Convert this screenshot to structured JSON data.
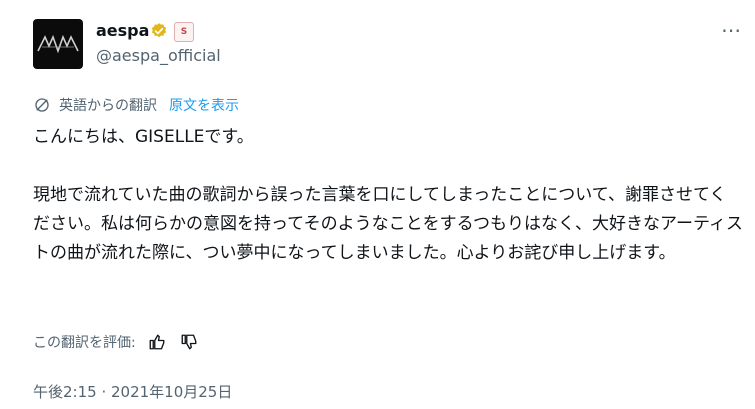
{
  "author": {
    "display_name": "aespa",
    "handle": "@aespa_official",
    "affiliate_badge": "S"
  },
  "translation": {
    "label": "英語からの翻訳",
    "show_original": "原文を表示"
  },
  "body": {
    "line1": "こんにちは、GISELLEです。",
    "paragraph": "現地で流れていた曲の歌詞から誤った言葉を口にしてしまったことについて、謝罪させてください。私は何らかの意図を持ってそのようなことをするつもりはなく、大好きなアーティストの曲が流れた際に、つい夢中になってしまいました。心よりお詫び申し上げます。"
  },
  "rating": {
    "label": "この翻訳を評価:"
  },
  "timestamp": "午後2:15 · 2021年10月25日",
  "colors": {
    "accent": "#1d9bf0",
    "verified_gold": "#e2b719",
    "secondary_text": "#536471"
  },
  "icons": {
    "more": "more-horizontal-icon",
    "translate": "translate-globe-icon",
    "thumbs_up": "thumbs-up-icon",
    "thumbs_down": "thumbs-down-icon",
    "verified": "verified-badge-icon"
  }
}
